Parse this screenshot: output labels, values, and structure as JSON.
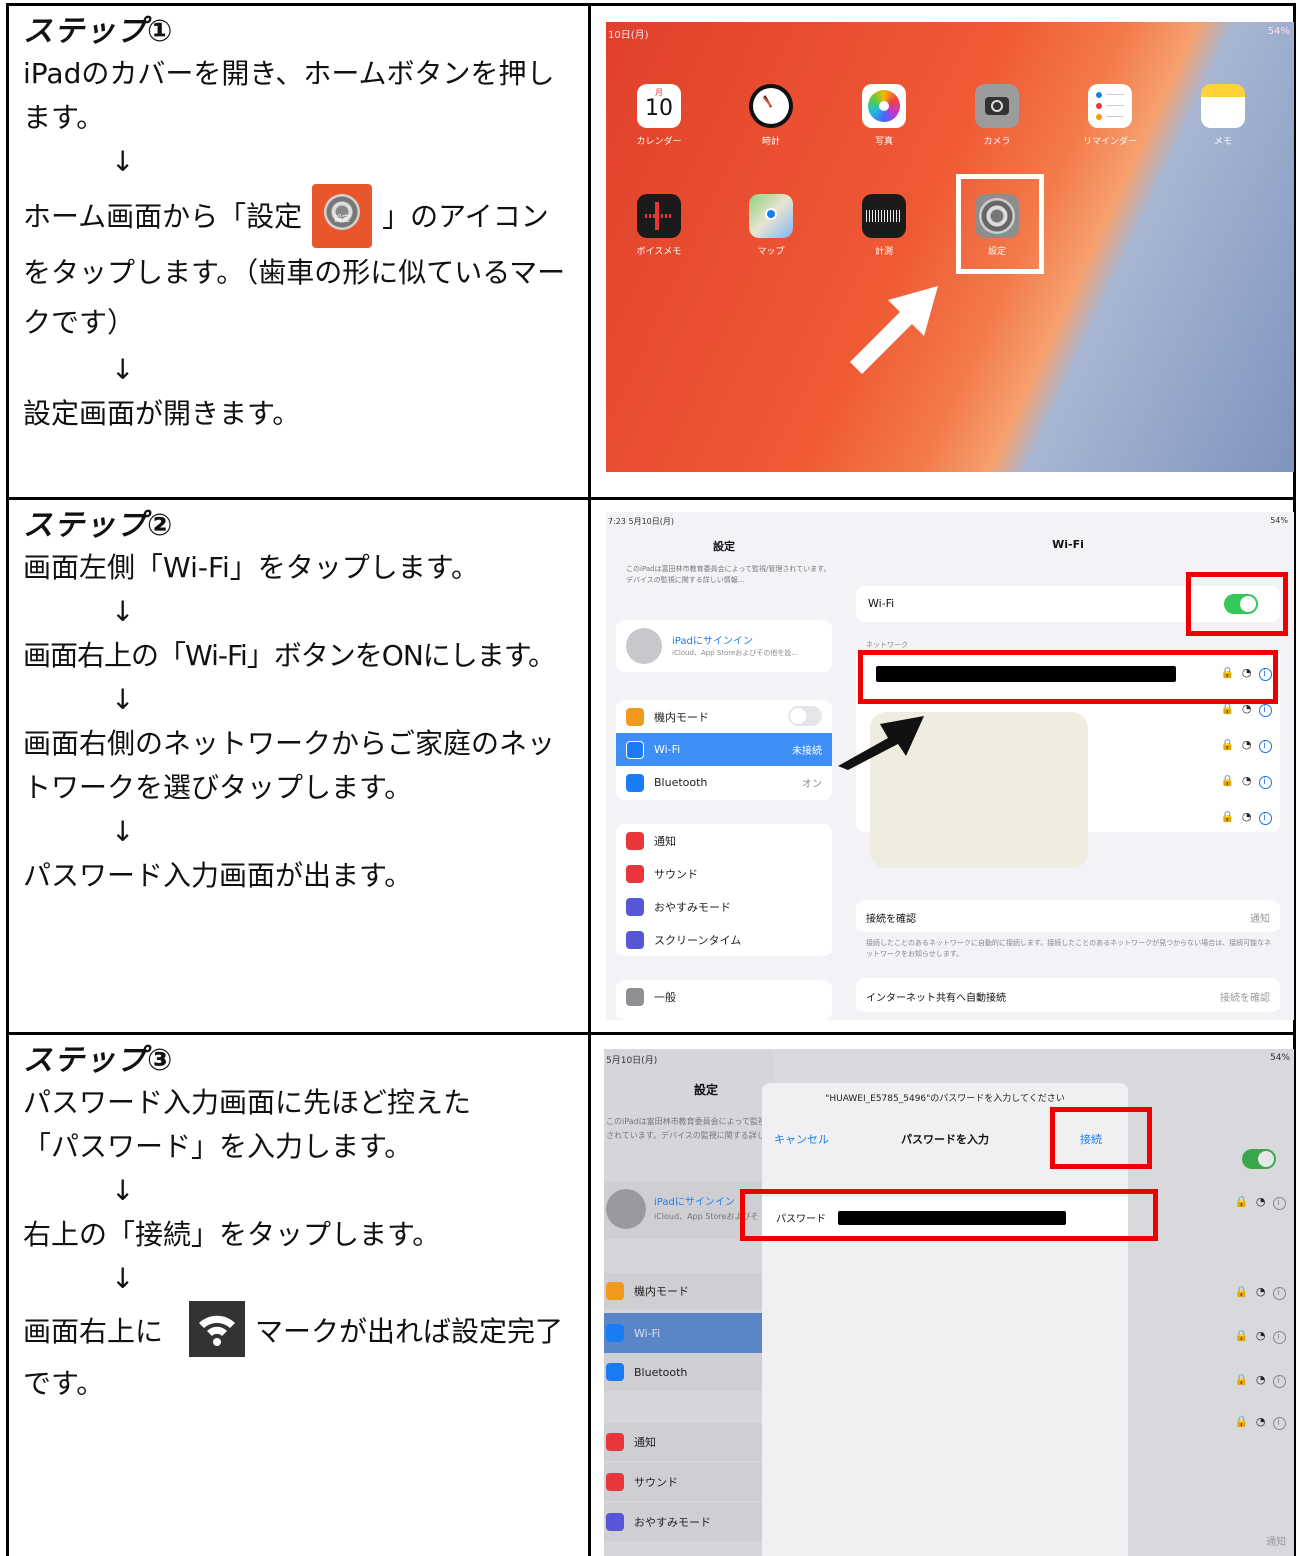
{
  "steps": [
    {
      "title": "ステップ①",
      "lines": [
        "iPadのカバーを開き、ホームボタンを押します。",
        "↓",
        "ホーム画面から「設定",
        "」のアイコンをタップします。（歯車の形に似ているマークです）",
        "↓",
        "設定画面が開きます。"
      ],
      "icon_gear": "settings-gear-icon",
      "gear_label": "設定"
    },
    {
      "title": "ステップ②",
      "lines": [
        "画面左側「Wi-Fi」をタップします。",
        "↓",
        "画面右上の「Wi-Fi」ボタンをONにします。",
        "↓",
        "画面右側のネットワークからご家庭のネットワークを選びタップします。",
        "↓",
        "パスワード入力画面が出ます。"
      ]
    },
    {
      "title": "ステップ③",
      "lines": [
        "パスワード入力画面に先ほど控えた「パスワード」を入力します。",
        "↓",
        "右上の「接続」をタップします。",
        "↓",
        "画面右上に",
        "マークが出れば設定完了です。"
      ],
      "icon_wifi": "wifi-icon"
    }
  ],
  "shot1": {
    "status_left": "10日(月)",
    "status_right": "54%",
    "apps_row1": [
      "カレンダー",
      "時計",
      "写真",
      "カメラ",
      "リマインダー",
      "メモ"
    ],
    "apps_row2": [
      "ボイスメモ",
      "マップ",
      "計測",
      "設定"
    ],
    "calendar_day_label": "月",
    "calendar_day": "10",
    "colors": {
      "highlight": "#ffffff",
      "arrow": "#ffffff"
    }
  },
  "shot2": {
    "status_left": "7:23  5月10日(月)",
    "status_right": "54%",
    "left_title": "設定",
    "notice": "このiPadは富田林市教育委員会によって監視/管理されています。デバイスの監視に関する詳しい情報...",
    "signin_title": "iPadにサインイン",
    "signin_sub": "iCloud、App Storeおよびその他を設...",
    "items": [
      {
        "label": "機内モード",
        "value": "",
        "icon": "airplane-icon",
        "color": "#f39a1e"
      },
      {
        "label": "Wi-Fi",
        "value": "未接続",
        "icon": "wifi-icon",
        "color": "#1a7cf2"
      },
      {
        "label": "Bluetooth",
        "value": "オン",
        "icon": "bluetooth-icon",
        "color": "#1a7cf2"
      },
      {
        "label": "通知",
        "value": "",
        "icon": "notification-icon",
        "color": "#e8363c"
      },
      {
        "label": "サウンド",
        "value": "",
        "icon": "sound-icon",
        "color": "#e8363c"
      },
      {
        "label": "おやすみモード",
        "value": "",
        "icon": "moon-icon",
        "color": "#5856d6"
      },
      {
        "label": "スクリーンタイム",
        "value": "",
        "icon": "hourglass-icon",
        "color": "#5856d6"
      },
      {
        "label": "一般",
        "value": "",
        "icon": "gear-icon",
        "color": "#8e8e93"
      }
    ],
    "right_title": "Wi-Fi",
    "wifi_label": "Wi-Fi",
    "networks_header": "ネットワーク",
    "ask_join": "接続を確認",
    "ask_join_value": "通知",
    "ask_join_desc": "接続したことのあるネットワークに自動的に接続します。接続したことのあるネットワークが見つからない場合は、接続可能なネットワークをお知らせします。",
    "hotspot": "インターネット共有へ自動接続",
    "hotspot_value": "接続を確認"
  },
  "shot3": {
    "status_left": "5月10日(月)",
    "status_right": "54%",
    "left_title": "設定",
    "notice": "このiPadは富田林市教育委員会によって監視されています。デバイスの監視に関する詳しい",
    "signin_title": "iPadにサインイン",
    "signin_sub": "iCloud、App Storeおよびそ",
    "items": [
      {
        "label": "機内モード",
        "icon": "airplane-icon",
        "color": "#f39a1e"
      },
      {
        "label": "Wi-Fi",
        "icon": "wifi-icon",
        "color": "#1a7cf2"
      },
      {
        "label": "Bluetooth",
        "icon": "bluetooth-icon",
        "color": "#1a7cf2"
      },
      {
        "label": "通知",
        "icon": "notification-icon",
        "color": "#e8363c"
      },
      {
        "label": "サウンド",
        "icon": "sound-icon",
        "color": "#e8363c"
      },
      {
        "label": "おやすみモード",
        "icon": "moon-icon",
        "color": "#5856d6"
      }
    ],
    "dialog_prompt": "\"HUAWEI_E5785_5496\"のパスワードを入力してください",
    "cancel": "キャンセル",
    "dialog_title": "パスワードを入力",
    "connect": "接続",
    "password_label": "パスワード",
    "footer_right": "通知"
  }
}
